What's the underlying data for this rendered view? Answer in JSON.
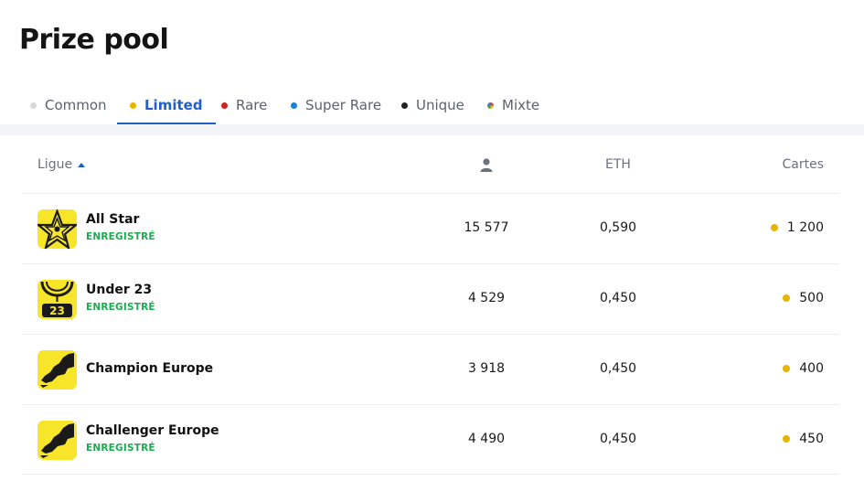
{
  "page": {
    "title": "Prize pool"
  },
  "tabs": [
    {
      "label": "Common",
      "color": "#d9d9d9",
      "active": false
    },
    {
      "label": "Limited",
      "color": "#e8b400",
      "active": true
    },
    {
      "label": "Rare",
      "color": "#d0201c",
      "active": false
    },
    {
      "label": "Super Rare",
      "color": "#1e7fd6",
      "active": false
    },
    {
      "label": "Unique",
      "color": "#222222",
      "active": false
    },
    {
      "label": "Mixte",
      "color": "rainbow",
      "active": false
    }
  ],
  "table": {
    "headers": {
      "league": "Ligue",
      "users_icon": "user-icon",
      "eth": "ETH",
      "cards": "Cartes"
    },
    "rows": [
      {
        "name": "All Star",
        "status": "ENREGISTRÉ",
        "users": "15 577",
        "eth": "0,590",
        "cards": "1 200",
        "logo": "star-logo"
      },
      {
        "name": "Under 23",
        "status": "ENREGISTRÉ",
        "users": "4 529",
        "eth": "0,450",
        "cards": "500",
        "logo": "under23-logo"
      },
      {
        "name": "Champion Europe",
        "status": "",
        "users": "3 918",
        "eth": "0,450",
        "cards": "400",
        "logo": "champion-europe-logo"
      },
      {
        "name": "Challenger Europe",
        "status": "ENREGISTRÉ",
        "users": "4 490",
        "eth": "0,450",
        "cards": "450",
        "logo": "challenger-europe-logo"
      }
    ]
  },
  "logo_text": {
    "under23": "23"
  },
  "colors": {
    "accent": "#1f5fc9",
    "registered": "#1faa52",
    "limited": "#e8b400",
    "logo_bg": "#f7e52a"
  }
}
